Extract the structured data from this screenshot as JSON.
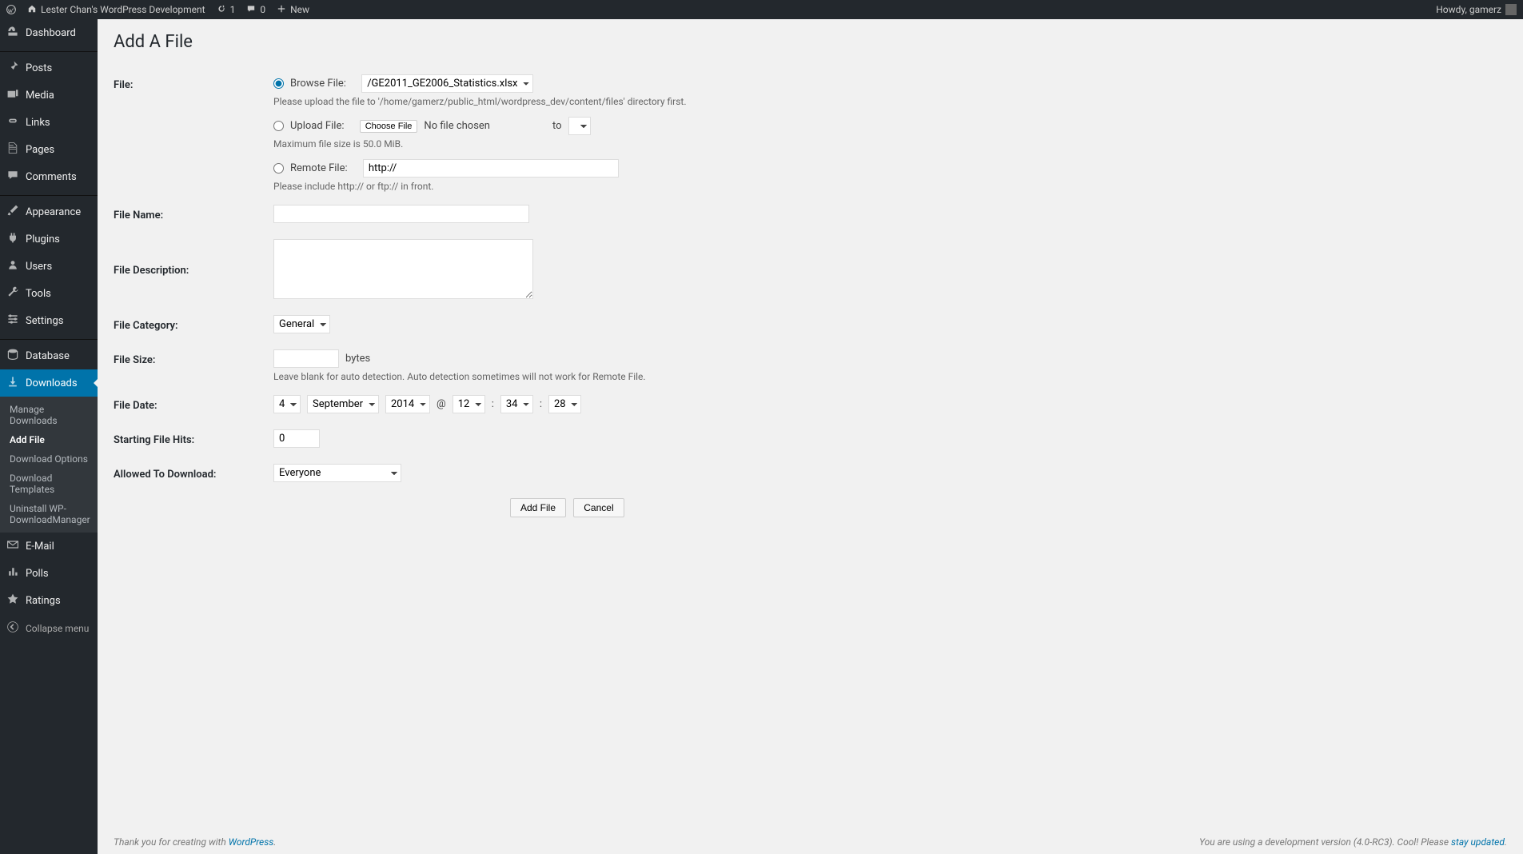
{
  "adminbar": {
    "site_title": "Lester Chan's WordPress Development",
    "updates": "1",
    "comments": "0",
    "new": "New",
    "howdy": "Howdy, gamerz"
  },
  "sidebar": {
    "dashboard": "Dashboard",
    "posts": "Posts",
    "media": "Media",
    "links": "Links",
    "pages": "Pages",
    "comments": "Comments",
    "appearance": "Appearance",
    "plugins": "Plugins",
    "users": "Users",
    "tools": "Tools",
    "settings": "Settings",
    "database": "Database",
    "downloads": "Downloads",
    "email": "E-Mail",
    "polls": "Polls",
    "ratings": "Ratings",
    "collapse": "Collapse menu",
    "submenu": {
      "manage": "Manage Downloads",
      "addfile": "Add File",
      "options": "Download Options",
      "templates": "Download Templates",
      "uninstall": "Uninstall WP-DownloadManager"
    }
  },
  "page": {
    "title": "Add A File",
    "labels": {
      "file": "File:",
      "filename": "File Name:",
      "filedesc": "File Description:",
      "filecat": "File Category:",
      "filesize": "File Size:",
      "filedate": "File Date:",
      "filehits": "Starting File Hits:",
      "allowed": "Allowed To Download:"
    },
    "browse": {
      "label": "Browse File:",
      "selected": "/GE2011_GE2006_Statistics.xlsx",
      "hint": "Please upload the file to '/home/gamerz/public_html/wordpress_dev/content/files' directory first."
    },
    "upload": {
      "label": "Upload File:",
      "choose": "Choose File",
      "nofile": "No file chosen",
      "to": "to",
      "hint": "Maximum file size is 50.0 MiB."
    },
    "remote": {
      "label": "Remote File:",
      "value": "http://",
      "hint": "Please include http:// or ftp:// in front."
    },
    "category": {
      "value": "General"
    },
    "size": {
      "unit": "bytes",
      "hint": "Leave blank for auto detection. Auto detection sometimes will not work for Remote File."
    },
    "date": {
      "day": "4",
      "month": "September",
      "year": "2014",
      "at": "@",
      "hour": "12",
      "min": "34",
      "sec": "28"
    },
    "hits": "0",
    "allowed": "Everyone",
    "buttons": {
      "add": "Add File",
      "cancel": "Cancel"
    }
  },
  "footer": {
    "thanks_pre": "Thank you for creating with ",
    "thanks_link": "WordPress",
    "dev_pre": "You are using a development version (4.0-RC3). Cool! Please ",
    "dev_link": "stay updated"
  }
}
